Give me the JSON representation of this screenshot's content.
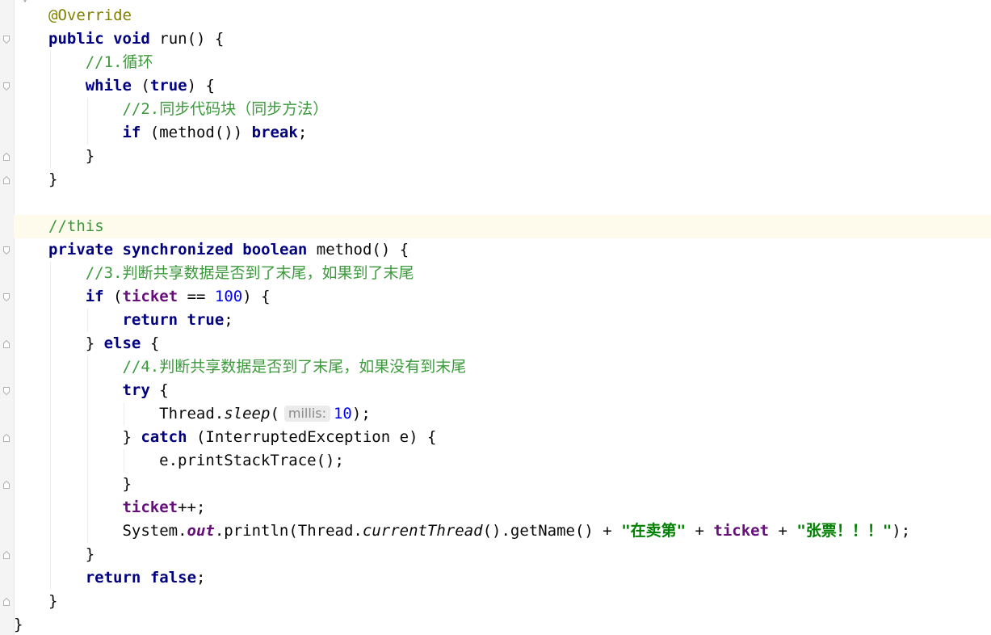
{
  "editor": {
    "lines": [
      [
        {
          "c": "ann",
          "t": "@Override"
        }
      ],
      [
        {
          "c": "kw",
          "t": "public"
        },
        {
          "t": " "
        },
        {
          "c": "kw",
          "t": "void"
        },
        {
          "t": " run() {"
        }
      ],
      [
        {
          "c": "cm",
          "t": "//1.循环"
        }
      ],
      [
        {
          "c": "kw",
          "t": "while"
        },
        {
          "t": " ("
        },
        {
          "c": "kw",
          "t": "true"
        },
        {
          "t": ") {"
        }
      ],
      [
        {
          "c": "cm",
          "t": "//2.同步代码块（同步方法）"
        }
      ],
      [
        {
          "c": "kw",
          "t": "if"
        },
        {
          "t": " (method()) "
        },
        {
          "c": "kw",
          "t": "break"
        },
        {
          "t": ";"
        }
      ],
      [
        {
          "t": "}"
        }
      ],
      [
        {
          "t": "}"
        }
      ],
      [],
      [
        {
          "c": "cm",
          "t": "//this"
        }
      ],
      [
        {
          "c": "kw",
          "t": "private"
        },
        {
          "t": " "
        },
        {
          "c": "kw",
          "t": "synchronized"
        },
        {
          "t": " "
        },
        {
          "c": "kw",
          "t": "boolean"
        },
        {
          "t": " method() {"
        }
      ],
      [
        {
          "c": "cm",
          "t": "//3.判断共享数据是否到了末尾，如果到了末尾"
        }
      ],
      [
        {
          "c": "kw",
          "t": "if"
        },
        {
          "t": " ("
        },
        {
          "c": "fld",
          "t": "ticket"
        },
        {
          "t": " == "
        },
        {
          "c": "num",
          "t": "100"
        },
        {
          "t": ") {"
        }
      ],
      [
        {
          "c": "kw",
          "t": "return"
        },
        {
          "t": " "
        },
        {
          "c": "kw",
          "t": "true"
        },
        {
          "t": ";"
        }
      ],
      [
        {
          "t": "} "
        },
        {
          "c": "kw",
          "t": "else"
        },
        {
          "t": " {"
        }
      ],
      [
        {
          "c": "cm",
          "t": "//4.判断共享数据是否到了末尾，如果没有到末尾"
        }
      ],
      [
        {
          "c": "kw",
          "t": "try"
        },
        {
          "t": " {"
        }
      ],
      [
        {
          "t": "Thread."
        },
        {
          "c": "it",
          "t": "sleep"
        },
        {
          "t": "("
        },
        {
          "c": "hint",
          "t": "millis:"
        },
        {
          "c": "num",
          "t": "10"
        },
        {
          "t": ");"
        }
      ],
      [
        {
          "t": "} "
        },
        {
          "c": "kw",
          "t": "catch"
        },
        {
          "t": " (InterruptedException e) {"
        }
      ],
      [
        {
          "t": "e.printStackTrace();"
        }
      ],
      [
        {
          "t": "}"
        }
      ],
      [
        {
          "c": "fld",
          "t": "ticket"
        },
        {
          "t": "++;"
        }
      ],
      [
        {
          "t": "System."
        },
        {
          "c": "sfld",
          "t": "out"
        },
        {
          "t": ".println(Thread."
        },
        {
          "c": "it",
          "t": "currentThread"
        },
        {
          "t": "().getName() + "
        },
        {
          "c": "str",
          "t": "\"在卖第\""
        },
        {
          "t": " + "
        },
        {
          "c": "fld",
          "t": "ticket"
        },
        {
          "t": " + "
        },
        {
          "c": "str",
          "t": "\"张票！！！\""
        },
        {
          "t": ");"
        }
      ],
      [
        {
          "t": "}"
        }
      ],
      [
        {
          "c": "kw",
          "t": "return"
        },
        {
          "t": " "
        },
        {
          "c": "kw",
          "t": "false"
        },
        {
          "t": ";"
        }
      ],
      [
        {
          "t": "}"
        }
      ],
      [
        {
          "t": "}"
        }
      ]
    ],
    "current_line": 9,
    "colors": {
      "background": "#ffffff",
      "current_line": "#fefbec",
      "keyword": "#000080",
      "comment": "#3c9a3c",
      "annotation": "#808000",
      "number": "#0000ff",
      "field": "#660e7a",
      "string": "#008000"
    }
  }
}
